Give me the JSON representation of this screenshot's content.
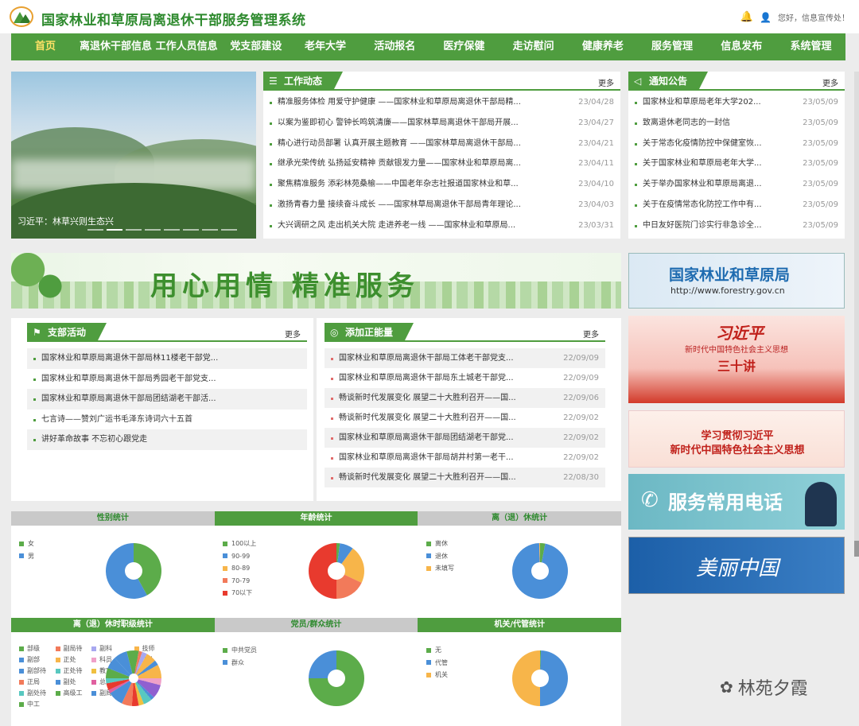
{
  "header": {
    "title": "国家林业和草原局离退休干部服务管理系统",
    "greeting": "您好，信息宣传处！",
    "bell": "bell-icon",
    "user": "user-icon"
  },
  "nav": [
    "首页",
    "离退休干部信息",
    "工作人员信息",
    "党支部建设",
    "老年大学",
    "活动报名",
    "医疗保健",
    "走访慰问",
    "健康养老",
    "服务管理",
    "信息发布",
    "系统管理"
  ],
  "slider": {
    "caption": "习近平：林草兴则生态兴"
  },
  "work": {
    "title": "工作动态",
    "more": "更多",
    "items": [
      {
        "t": "精准服务体检 用爱守护健康 ——国家林业和草原局离退休干部局精...",
        "d": "23/04/28"
      },
      {
        "t": "以案为鉴即初心 警钟长鸣筑清廉——国家林草局离退休干部局开展...",
        "d": "23/04/27"
      },
      {
        "t": "精心进行动员部署 认真开展主题教育 ——国家林草局离退休干部局...",
        "d": "23/04/21"
      },
      {
        "t": "继承光荣传统 弘扬延安精神 贡献银发力量——国家林业和草原局离...",
        "d": "23/04/11"
      },
      {
        "t": "聚焦精准服务 添彩林苑桑榆——中国老年杂志社报道国家林业和草...",
        "d": "23/04/10"
      },
      {
        "t": "激扬青春力量 接续奋斗成长 ——国家林草局离退休干部局青年理论...",
        "d": "23/04/03"
      },
      {
        "t": "大兴调研之风 走出机关大院 走进养老一线 ——国家林业和草原局...",
        "d": "23/03/31"
      }
    ]
  },
  "notice": {
    "title": "通知公告",
    "more": "更多",
    "items": [
      {
        "t": "国家林业和草原局老年大学202...",
        "d": "23/05/09"
      },
      {
        "t": "致离退休老同志的一封信",
        "d": "23/05/09"
      },
      {
        "t": "关于常态化疫情防控中保健室恢...",
        "d": "23/05/09"
      },
      {
        "t": "关于国家林业和草原局老年大学...",
        "d": "23/05/09"
      },
      {
        "t": "关于举办国家林业和草原局离退...",
        "d": "23/05/09"
      },
      {
        "t": "关于在疫情常态化防控工作中有...",
        "d": "23/05/09"
      },
      {
        "t": "中日友好医院门诊实行非急诊全...",
        "d": "23/05/09"
      }
    ]
  },
  "banner": {
    "text": "用心用情 精准服务"
  },
  "branch": {
    "title": "支部活动",
    "more": "更多",
    "items": [
      {
        "t": "国家林业和草原局离退休干部局林11楼老干部党..."
      },
      {
        "t": "国家林业和草原局离退休干部局秀园老干部党支..."
      },
      {
        "t": "国家林业和草原局离退休干部局团结湖老干部活..."
      },
      {
        "t": "七言诗——赞刘广运书毛泽东诗词六十五首"
      },
      {
        "t": "讲好革命故事 不忘初心跟党走"
      }
    ]
  },
  "energy": {
    "title": "添加正能量",
    "more": "更多",
    "items": [
      {
        "t": "国家林业和草原局离退休干部局工体老干部党支...",
        "d": "22/09/09"
      },
      {
        "t": "国家林业和草原局离退休干部局东土城老干部党...",
        "d": "22/09/09"
      },
      {
        "t": "畅谈新时代发展变化 展望二十大胜利召开——国...",
        "d": "22/09/06"
      },
      {
        "t": "畅谈新时代发展变化 展望二十大胜利召开——国...",
        "d": "22/09/02"
      },
      {
        "t": "国家林业和草原局离退休干部局团结湖老干部党...",
        "d": "22/09/02"
      },
      {
        "t": "国家林业和草原局离退休干部局胡井村第一老干...",
        "d": "22/09/02"
      },
      {
        "t": "畅谈新时代发展变化 展望二十大胜利召开——国...",
        "d": "22/08/30"
      }
    ]
  },
  "side": {
    "forestry": "国家林业和草原局",
    "url": "http://www.forestry.gov.cn",
    "xi1": "习近平",
    "xi2": "新时代中国特色社会主义思想",
    "xi3": "三十讲",
    "study1": "学习贯彻习近平",
    "study2": "新时代中国特色社会主义思想",
    "phone": "服务常用电话",
    "mei": "美丽中国"
  },
  "stats_row1": [
    "性别统计",
    "年龄统计",
    "离（退）休统计"
  ],
  "stats_row2": [
    "离（退）休时职级统计",
    "党员/群众统计",
    "机关/代管统计"
  ],
  "watermark": "林苑夕霞",
  "chart_data": [
    {
      "type": "pie",
      "title": "性别统计",
      "legend": [
        "女",
        "男"
      ],
      "values": [
        42,
        58
      ],
      "colors": [
        "#5cac4a",
        "#4a8fd8"
      ]
    },
    {
      "type": "pie",
      "title": "年龄统计",
      "legend": [
        "100以上",
        "90-99",
        "80-89",
        "70-79",
        "70以下"
      ],
      "values": [
        2,
        8,
        22,
        18,
        50
      ],
      "colors": [
        "#5cac4a",
        "#4a8fd8",
        "#f7b54a",
        "#f27a5a",
        "#e83a2e"
      ]
    },
    {
      "type": "pie",
      "title": "离（退）休统计",
      "legend": [
        "离休",
        "退休",
        "未填写"
      ],
      "values": [
        3,
        97,
        0.5
      ],
      "colors": [
        "#5cac4a",
        "#4a8fd8",
        "#f7b54a"
      ]
    },
    {
      "type": "pie",
      "title": "离（退）休时职级统计",
      "legend": [
        "部级",
        "副局待",
        "副科",
        "技师",
        "副部",
        "正处",
        "科员",
        "工人",
        "副部待",
        "正处待",
        "教室",
        "其他",
        "正局",
        "副处",
        "总经济师",
        "正局待",
        "副处待",
        "高级工",
        "副局",
        "正科",
        "中工"
      ],
      "values": [
        3,
        2,
        3,
        6,
        3,
        8,
        4,
        8,
        2,
        5,
        3,
        4,
        6,
        9,
        2,
        4,
        3,
        6,
        7,
        8,
        4
      ],
      "colors": [
        "#5cac4a",
        "#f27a5a",
        "#a8a8f0",
        "#f7b54a",
        "#4a8fd8",
        "#f7b54a",
        "#f0a0c8",
        "#9060d0",
        "#4a8fd8",
        "#58c8c0",
        "#f0c040",
        "#e83a2e",
        "#f27a5a",
        "#4a8fd8",
        "#e060a0",
        "#e83a2e",
        "#58c8c0",
        "#5cac4a",
        "#4a8fd8",
        "#4a8fd8",
        "#5cac4a"
      ]
    },
    {
      "type": "pie",
      "title": "党员/群众统计",
      "legend": [
        "中共党员",
        "群众"
      ],
      "values": [
        75,
        25
      ],
      "colors": [
        "#5cac4a",
        "#4a8fd8"
      ]
    },
    {
      "type": "pie",
      "title": "机关/代管统计",
      "legend": [
        "无",
        "代管",
        "机关"
      ],
      "values": [
        0.5,
        49.5,
        50
      ],
      "colors": [
        "#5cac4a",
        "#4a8fd8",
        "#f7b54a"
      ]
    }
  ]
}
